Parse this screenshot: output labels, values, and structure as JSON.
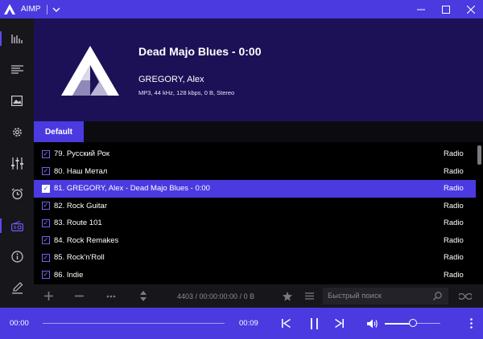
{
  "titlebar": {
    "app_name": "AIMP"
  },
  "now_playing": {
    "title": "Dead Majo Blues - 0:00",
    "artist": "GREGORY, Alex",
    "info": "MP3, 44 kHz, 128 kbps, 0 B, Stereo"
  },
  "tabs": [
    {
      "label": "Default",
      "active": true
    }
  ],
  "playlist": {
    "rows": [
      {
        "title": "79. Русский Рок",
        "genre": "Radio",
        "selected": false
      },
      {
        "title": "80. Наш Метал",
        "genre": "Radio",
        "selected": false
      },
      {
        "title": "81. GREGORY, Alex - Dead Majo Blues - 0:00",
        "genre": "Radio",
        "selected": true
      },
      {
        "title": "82. Rock Guitar",
        "genre": "Radio",
        "selected": false
      },
      {
        "title": "83. Route 101",
        "genre": "Radio",
        "selected": false
      },
      {
        "title": "84. Rock Remakes",
        "genre": "Radio",
        "selected": false
      },
      {
        "title": "85. Rock'n'Roll",
        "genre": "Radio",
        "selected": false
      },
      {
        "title": "86. Indie",
        "genre": "Radio",
        "selected": false
      }
    ]
  },
  "pl_toolbar": {
    "stats": "4403 / 00:00:00:00 / 0 B",
    "search_placeholder": "Быстрый поиск"
  },
  "player": {
    "elapsed": "00:00",
    "duration": "00:09",
    "volume_level": 0.5
  },
  "colors": {
    "accent": "#4a3ae0",
    "header_bg": "#1c1157",
    "sidebar_bg": "#17171b"
  },
  "icons": {
    "sidebar": [
      "equalizer-bars-icon",
      "playlist-icon",
      "album-art-icon",
      "settings-gear-icon",
      "mixer-sliders-icon",
      "alarm-clock-icon",
      "radio-icon",
      "info-icon",
      "edit-icon"
    ]
  }
}
